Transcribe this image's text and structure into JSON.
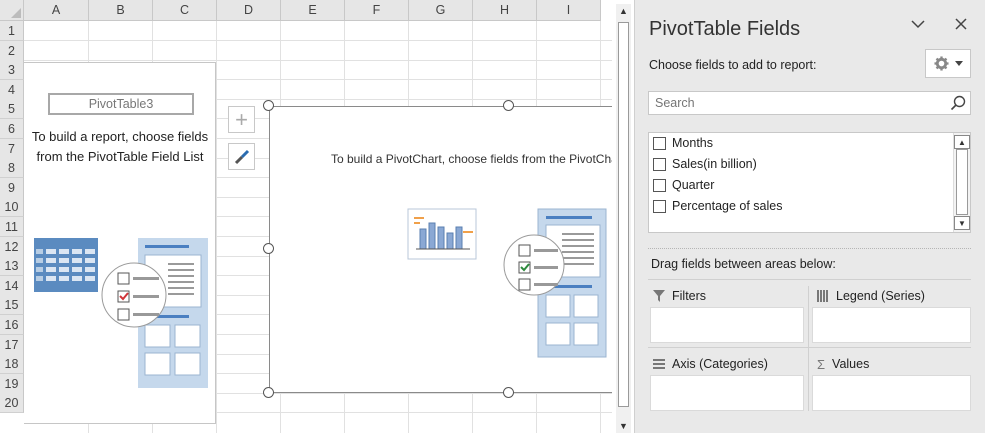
{
  "columns": [
    "A",
    "B",
    "C",
    "D",
    "E",
    "F",
    "G",
    "H",
    "I"
  ],
  "rows": [
    "1",
    "2",
    "3",
    "4",
    "5",
    "6",
    "7",
    "8",
    "9",
    "10",
    "11",
    "12",
    "13",
    "14",
    "15",
    "16",
    "17",
    "18",
    "19",
    "20"
  ],
  "pivot_table": {
    "name": "PivotTable3",
    "instruction": "To build a report, choose fields from the PivotTable Field List"
  },
  "pivot_chart": {
    "instruction": "To build a PivotChart, choose fields from the PivotChart Field List"
  },
  "chart_buttons": {
    "add": "+"
  },
  "panel": {
    "title": "PivotTable Fields",
    "choose_label": "Choose fields to add to report:",
    "search_placeholder": "Search",
    "fields": [
      {
        "label": "Months",
        "checked": false
      },
      {
        "label": "Sales(in billion)",
        "checked": false
      },
      {
        "label": "Quarter",
        "checked": false
      },
      {
        "label": "Percentage of sales",
        "checked": false
      }
    ],
    "drag_label": "Drag fields between areas below:",
    "areas": {
      "filters": "Filters",
      "legend": "Legend (Series)",
      "axis": "Axis (Categories)",
      "values": "Values"
    }
  },
  "icons": {
    "filter": "filter-icon",
    "legend": "legend-icon",
    "axis": "axis-icon",
    "values": "sigma-icon",
    "gear": "gear-icon",
    "search": "search-icon",
    "close": "close-icon",
    "chevron": "chevron-down-icon"
  }
}
